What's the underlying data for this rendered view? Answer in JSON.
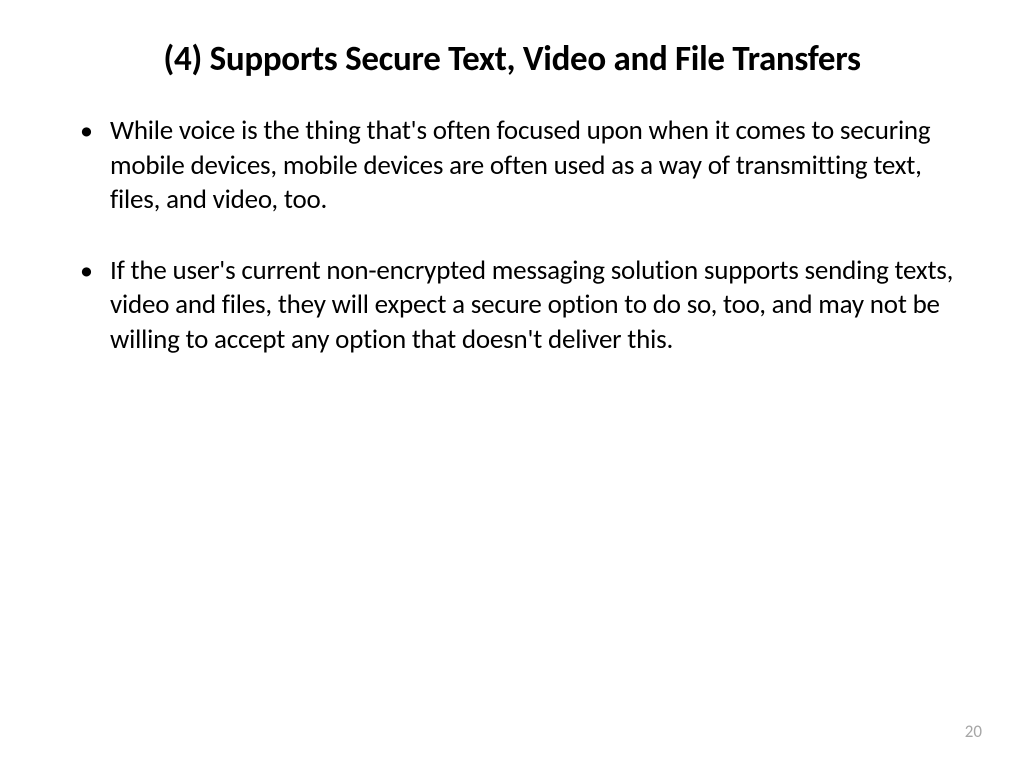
{
  "slide": {
    "title": "(4) Supports Secure Text, Video and File Transfers",
    "bullets": [
      "While voice is the thing that's often focused upon when it comes to securing mobile devices, mobile devices are often used as a way of transmitting text, files, and video, too.",
      "If the user's current non-encrypted messaging solution supports sending texts, video and files, they will expect a secure option to do so, too, and may not be willing to accept any option that doesn't deliver this."
    ],
    "pageNumber": "20"
  }
}
